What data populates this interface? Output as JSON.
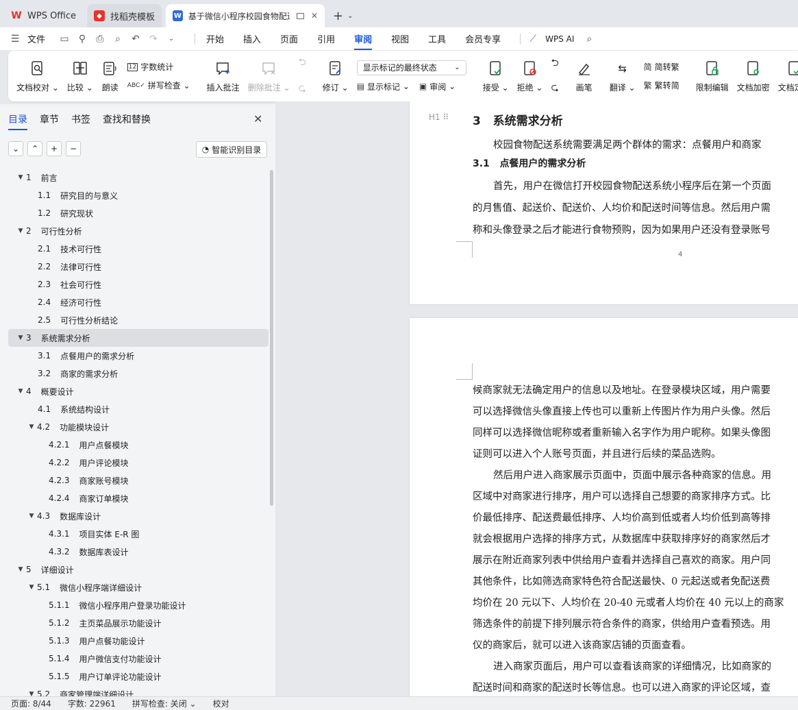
{
  "tabs": [
    {
      "label": "WPS Office",
      "icon": "wps-logo-icon",
      "color": "#e5342a"
    },
    {
      "label": "找稻壳模板",
      "icon": "docer-logo-icon",
      "color": "#e5342a"
    },
    {
      "label": "基于微信小程序校园食物配送",
      "icon": "writer-logo-icon",
      "color": "#2e6bd8"
    }
  ],
  "menu": {
    "file": "文件",
    "items": [
      "开始",
      "插入",
      "页面",
      "引用",
      "审阅",
      "视图",
      "工具",
      "会员专享"
    ],
    "active": "审阅",
    "ai": "WPS AI"
  },
  "ribbon": {
    "proofread": "文档校对",
    "compare": "比较",
    "read_aloud": "朗读",
    "word_count": "字数统计",
    "spell_check": "拼写检查",
    "insert_comment": "插入批注",
    "delete_comment": "删除批注",
    "revise": "修订",
    "display_select": "显示标记的最终状态",
    "show_markup": "显示标记",
    "review": "审阅",
    "accept": "接受",
    "reject": "拒绝",
    "brush": "画笔",
    "translate": "翻译",
    "to_traditional": "简转繁",
    "to_simplified": "繁转简",
    "restrict": "限制编辑",
    "encrypt": "文档加密",
    "finalize": "文档定稿"
  },
  "panel": {
    "tabs": [
      "目录",
      "章节",
      "书签",
      "查找和替换"
    ],
    "active_tab": "目录",
    "smart_button": "智能识别目录",
    "toc": [
      {
        "num": "1",
        "title": "前言",
        "level": 1,
        "expanded": true
      },
      {
        "num": "1.1",
        "title": "研究目的与意义",
        "level": 2
      },
      {
        "num": "1.2",
        "title": "研究现状",
        "level": 2
      },
      {
        "num": "2",
        "title": "可行性分析",
        "level": 1,
        "expanded": true
      },
      {
        "num": "2.1",
        "title": "技术可行性",
        "level": 2
      },
      {
        "num": "2.2",
        "title": "法律可行性",
        "level": 2
      },
      {
        "num": "2.3",
        "title": "社会可行性",
        "level": 2
      },
      {
        "num": "2.4",
        "title": "经济可行性",
        "level": 2
      },
      {
        "num": "2.5",
        "title": "可行性分析结论",
        "level": 2
      },
      {
        "num": "3",
        "title": "系统需求分析",
        "level": 1,
        "expanded": true,
        "selected": true
      },
      {
        "num": "3.1",
        "title": "点餐用户的需求分析",
        "level": 2
      },
      {
        "num": "3.2",
        "title": "商家的需求分析",
        "level": 2
      },
      {
        "num": "4",
        "title": "概要设计",
        "level": 1,
        "expanded": true
      },
      {
        "num": "4.1",
        "title": "系统结构设计",
        "level": 2
      },
      {
        "num": "4.2",
        "title": "功能模块设计",
        "level": 2,
        "expanded": true
      },
      {
        "num": "4.2.1",
        "title": "用户点餐模块",
        "level": 3
      },
      {
        "num": "4.2.2",
        "title": "用户评论模块",
        "level": 3
      },
      {
        "num": "4.2.3",
        "title": "商家账号模块",
        "level": 3
      },
      {
        "num": "4.2.4",
        "title": "商家订单模块",
        "level": 3
      },
      {
        "num": "4.3",
        "title": "数据库设计",
        "level": 2,
        "expanded": true
      },
      {
        "num": "4.3.1",
        "title": "项目实体 E-R 图",
        "level": 3
      },
      {
        "num": "4.3.2",
        "title": "数据库表设计",
        "level": 3
      },
      {
        "num": "5",
        "title": "详细设计",
        "level": 1,
        "expanded": true
      },
      {
        "num": "5.1",
        "title": "微信小程序端详细设计",
        "level": 2,
        "expanded": true
      },
      {
        "num": "5.1.1",
        "title": "微信小程序用户登录功能设计",
        "level": 3
      },
      {
        "num": "5.1.2",
        "title": "主页菜品展示功能设计",
        "level": 3
      },
      {
        "num": "5.1.3",
        "title": "用户点餐功能设计",
        "level": 3
      },
      {
        "num": "5.1.4",
        "title": "用户微信支付功能设计",
        "level": 3
      },
      {
        "num": "5.1.5",
        "title": "用户订单评论功能设计",
        "level": 3
      },
      {
        "num": "5.2",
        "title": "商家管理端详细设计",
        "level": 2,
        "expanded": true
      }
    ]
  },
  "doc": {
    "page1": {
      "heading_num": "3",
      "heading": "系统需求分析",
      "lines": [
        "校园食物配送系统需要满足两个群体的需求：点餐用户和商家",
        "首先，用户在微信打开校园食物配送系统小程序后在第一个页面",
        "的月售值、起送价、配送价、人均价和配送时间等信息。然后用户需",
        "称和头像登录之后才能进行食物预购，因为如果用户还没有登录账号"
      ],
      "subheading_num": "3.1",
      "subheading": "点餐用户的需求分析",
      "page_number": "4",
      "heading_marker": "H1"
    },
    "page2": {
      "lines": [
        "候商家就无法确定用户的信息以及地址。在登录模块区域，用户需要",
        "可以选择微信头像直接上传也可以重新上传图片作为用户头像。然后",
        "同样可以选择微信昵称或者重新输入名字作为用户昵称。如果头像图",
        "证则可以进入个人账号页面，并且进行后续的菜品选购。",
        "然后用户进入商家展示页面中，页面中展示各种商家的信息。用",
        "区域中对商家进行排序，用户可以选择自己想要的商家排序方式。比",
        "价最低排序、配送费最低排序、人均价高到低或者人均价低到高等排",
        "就会根据用户选择的排序方式，从数据库中获取排序好的商家然后才",
        "展示在附近商家列表中供给用户查看并选择自己喜欢的商家。用户同",
        "其他条件，比如筛选商家特色符合配送最快、0 元起送或者免配送费",
        "均价在 20 元以下、人均价在 20-40 元或者人均价在 40 元以上的商家",
        "筛选条件的前提下排列展示符合条件的商家，供给用户查看预选。用",
        "仪的商家后，就可以进入该商家店铺的页面查看。",
        "进入商家页面后，用户可以查看该商家的详细情况，比如商家的",
        "配送时间和商家的配送时长等信息。也可以进入商家的评论区域，查"
      ],
      "indented": [
        0,
        4,
        13
      ]
    }
  },
  "status": {
    "page": "页面: 8/44",
    "words": "字数: 22961",
    "spell": "拼写检查: 关闭",
    "proof": "校对"
  }
}
